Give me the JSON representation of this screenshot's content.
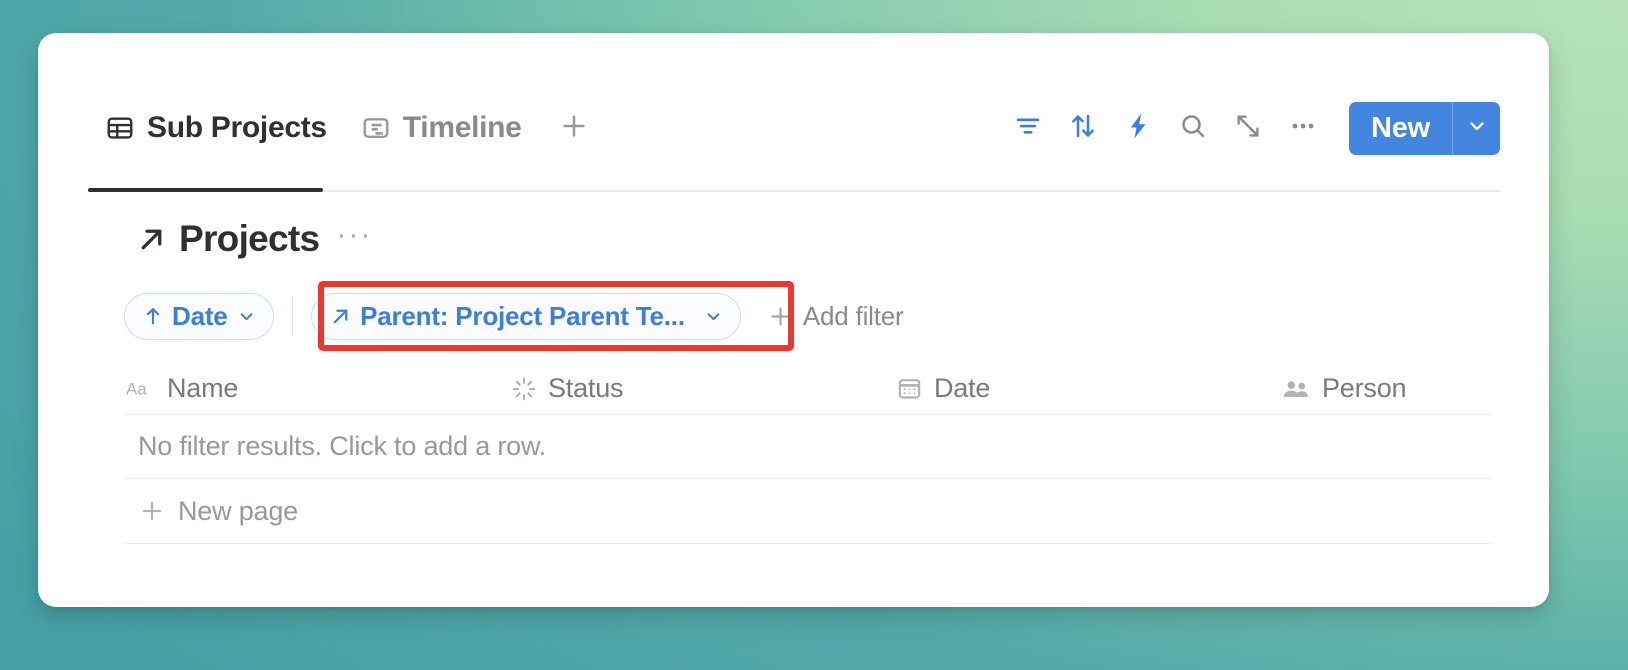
{
  "theme": {
    "accent_blue": "#3b7ee0",
    "button_blue": "#4485e0",
    "highlight_red": "#e8382f",
    "text_dark": "#32302c",
    "text_muted": "#8c8a87",
    "card_background": "#ffffff"
  },
  "toolbar": {
    "tabs": [
      {
        "label": "Sub Projects",
        "icon": "table-icon",
        "active": true
      },
      {
        "label": "Timeline",
        "icon": "timeline-icon",
        "active": false
      }
    ],
    "add_view_icon": "plus-icon",
    "actions": [
      {
        "name": "filter-icon",
        "tone": "blue"
      },
      {
        "name": "sort-icon",
        "tone": "blue"
      },
      {
        "name": "automation-lightning-icon",
        "tone": "blue"
      },
      {
        "name": "search-icon",
        "tone": "grey"
      },
      {
        "name": "expand-icon",
        "tone": "grey"
      },
      {
        "name": "more-options-icon",
        "tone": "grey"
      }
    ],
    "new_label": "New",
    "new_dropdown_icon": "chevron-down-icon"
  },
  "database": {
    "title": "Projects",
    "title_icon": "arrow-up-right-icon",
    "more_label": "···"
  },
  "chips": {
    "sort": {
      "label": "Date",
      "icon": "arrow-up-icon",
      "caret": "chevron-down-icon"
    },
    "filter": {
      "label": "Parent: Project Parent Te...",
      "icon": "arrow-up-right-icon",
      "caret": "chevron-down-icon",
      "highlighted": true
    },
    "add_filter_label": "Add filter",
    "add_filter_icon": "plus-icon"
  },
  "table": {
    "columns": [
      {
        "label": "Name",
        "icon": "text-aa-icon"
      },
      {
        "label": "Status",
        "icon": "status-spinner-icon"
      },
      {
        "label": "Date",
        "icon": "calendar-icon"
      },
      {
        "label": "Person",
        "icon": "people-icon"
      }
    ],
    "empty_state": "No filter results. Click to add a row.",
    "new_page_label": "New page",
    "new_page_icon": "plus-icon"
  }
}
